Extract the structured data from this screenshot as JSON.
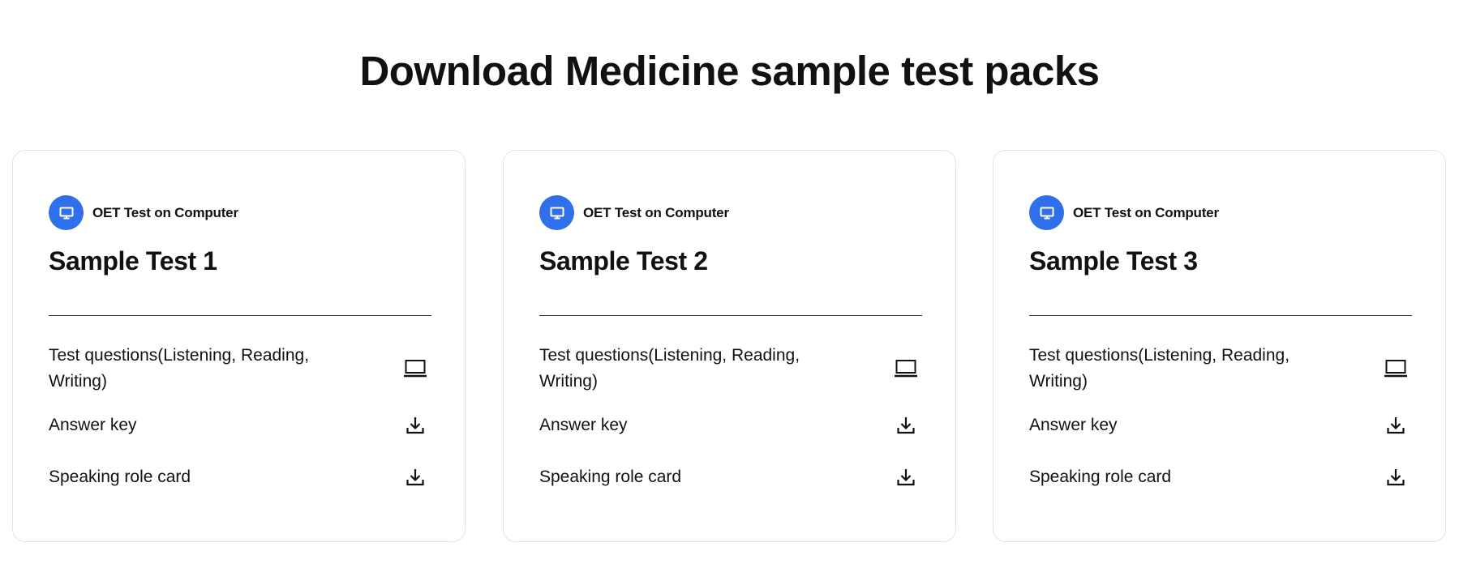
{
  "heading": "Download Medicine sample test packs",
  "colors": {
    "accent": "#2f6fea",
    "text": "#111111",
    "card_border": "#e3e3e3"
  },
  "cards": [
    {
      "badge": {
        "icon": "monitor-icon",
        "label": "OET Test on Computer"
      },
      "title": "Sample Test 1",
      "items": [
        {
          "label": "Test questions(Listening, Reading, Writing)",
          "icon": "laptop-icon"
        },
        {
          "label": "Answer key",
          "icon": "download-icon"
        },
        {
          "label": "Speaking role card",
          "icon": "download-icon"
        }
      ]
    },
    {
      "badge": {
        "icon": "monitor-icon",
        "label": "OET Test on Computer"
      },
      "title": "Sample Test 2",
      "items": [
        {
          "label": "Test questions(Listening, Reading, Writing)",
          "icon": "laptop-icon"
        },
        {
          "label": "Answer key",
          "icon": "download-icon"
        },
        {
          "label": "Speaking role card",
          "icon": "download-icon"
        }
      ]
    },
    {
      "badge": {
        "icon": "monitor-icon",
        "label": "OET Test on Computer"
      },
      "title": "Sample Test 3",
      "items": [
        {
          "label": "Test questions(Listening, Reading, Writing)",
          "icon": "laptop-icon"
        },
        {
          "label": "Answer key",
          "icon": "download-icon"
        },
        {
          "label": "Speaking role card",
          "icon": "download-icon"
        }
      ]
    }
  ]
}
